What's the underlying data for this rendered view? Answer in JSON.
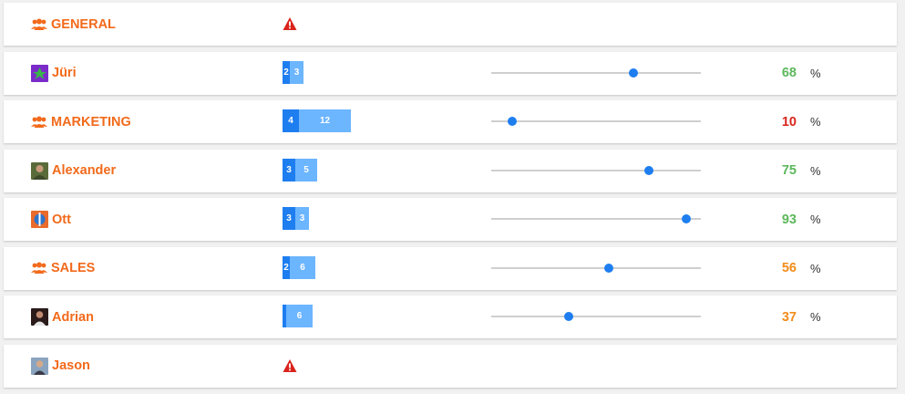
{
  "colors": {
    "accent_orange": "#f26a1b",
    "bar_dark": "#1e7ef0",
    "bar_light": "#6cb5ff",
    "green": "#5cb85c",
    "red": "#d9241c",
    "orange": "#f28c1b"
  },
  "rows": [
    {
      "type": "group",
      "name": "GENERAL",
      "warning": true
    },
    {
      "type": "user",
      "name": "Jüri",
      "avatar": "green-avatar",
      "bar": {
        "dark": "2",
        "light": "3"
      },
      "slider": 0.68,
      "percent": "68",
      "percent_color": "green",
      "percent_sign": "%"
    },
    {
      "type": "group",
      "name": "MARKETING",
      "bar": {
        "dark": "4",
        "light": "12"
      },
      "slider": 0.1,
      "percent": "10",
      "percent_color": "red",
      "percent_sign": "%"
    },
    {
      "type": "user",
      "name": "Alexander",
      "avatar": "photo-avatar",
      "bar": {
        "dark": "3",
        "light": "5"
      },
      "slider": 0.75,
      "percent": "75",
      "percent_color": "green",
      "percent_sign": "%"
    },
    {
      "type": "user",
      "name": "Ott",
      "avatar": "blue-orange-avatar",
      "bar": {
        "dark": "3",
        "light": "3"
      },
      "slider": 0.93,
      "percent": "93",
      "percent_color": "green",
      "percent_sign": "%"
    },
    {
      "type": "group",
      "name": "SALES",
      "bar": {
        "dark": "2",
        "light": "6"
      },
      "slider": 0.56,
      "percent": "56",
      "percent_color": "orange",
      "percent_sign": "%"
    },
    {
      "type": "user",
      "name": "Adrian",
      "avatar": "photo-avatar",
      "bar": {
        "dark": "",
        "light": "6"
      },
      "slider": 0.37,
      "percent": "37",
      "percent_color": "orange",
      "percent_sign": "%"
    },
    {
      "type": "user",
      "name": "Jason",
      "avatar": "photo-avatar",
      "warning": true
    }
  ]
}
